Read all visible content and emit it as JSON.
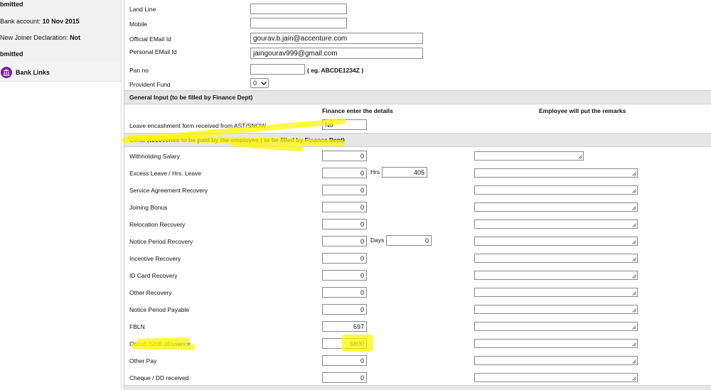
{
  "sidebar": {
    "status_submitted_1": "bmitted",
    "bank_account_label": "Bank account:",
    "bank_account_date": "10 Nov 2015",
    "new_joiner_label": "New Joiner Declaration:",
    "new_joiner_value": "Not",
    "status_submitted_2": "bmitted",
    "bank_links": "Bank Links"
  },
  "contact": {
    "land_line_label": "Land Line",
    "land_line_value": "",
    "mobile_label": "Mobile",
    "mobile_value": "",
    "official_email_label": "Official EMail Id",
    "official_email_value": "gourav.b.jain@accenture.com",
    "personal_email_label": "Personal EMail Id",
    "personal_email_value": "jaingourav999@gmail.com",
    "pan_label": "Pan no",
    "pan_value": "",
    "pan_hint": "( eg. ABCDE1234Z )",
    "pf_label": "Provident Fund",
    "pf_value": "0"
  },
  "general": {
    "section_title": "General Input (to be filled by Finance Dept)",
    "finance_header": "Finance enter the details",
    "employee_header": "Employee will put the remarks",
    "leave_form_label": "Leave encashment form received from AST/SNOW",
    "leave_form_value": "No"
  },
  "recoveries": {
    "section_title": "Other Recoveries to be paid by the employee ( to be filled by Finance Dept)",
    "hrs_label": "Hrs",
    "hrs_value": "405",
    "days_label": "Days",
    "days_value": "0",
    "rows": [
      {
        "label": "Withholding Salary",
        "value": "0"
      },
      {
        "label": "Excess Leave / Hrs.   Leave",
        "value": "0"
      },
      {
        "label": "Service Agreement Recovery",
        "value": "0"
      },
      {
        "label": "Joining Bonus",
        "value": "0"
      },
      {
        "label": "Relocation Recovery",
        "value": "0"
      },
      {
        "label": "Notice Period Recovery",
        "value": "0"
      },
      {
        "label": "Incentive Recovery",
        "value": "0"
      },
      {
        "label": "ID Card Recovery",
        "value": "0"
      },
      {
        "label": "Other Recovery",
        "value": "0"
      },
      {
        "label": "Notice Period Payable",
        "value": "0"
      },
      {
        "label": "FBLN",
        "value": "697"
      },
      {
        "label": "Oncall /Shift allowance",
        "value": "6800"
      },
      {
        "label": "Other Pay",
        "value": "0"
      },
      {
        "label": "Cheque / DD received",
        "value": "0"
      }
    ]
  },
  "colors": {
    "highlight": "#fff500",
    "section_bg": "#e6e6e6",
    "bank_icon": "#7a1fa2"
  },
  "icons": [
    "bank-icon",
    "dropdown-chevron-icon",
    "resize-grip-icon"
  ]
}
